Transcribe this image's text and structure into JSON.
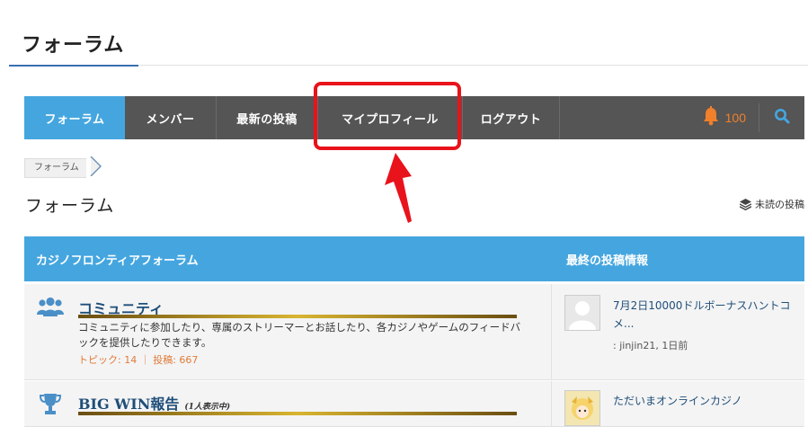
{
  "page": {
    "title": "フォーラム"
  },
  "nav": {
    "items": [
      {
        "label": "フォーラム"
      },
      {
        "label": "メンバー"
      },
      {
        "label": "最新の投稿"
      },
      {
        "label": "マイプロフィール"
      },
      {
        "label": "ログアウト"
      }
    ],
    "notification_count": "100"
  },
  "breadcrumb": {
    "label": "フォーラム"
  },
  "section": {
    "title": "フォーラム",
    "unread_label": "未読の投稿"
  },
  "table": {
    "col_forum": "カジノフロンティアフォーラム",
    "col_last": "最終の投稿情報"
  },
  "forums": [
    {
      "name": "コミュニティ",
      "description": "コミュニティに参加したり、専属のストリーマーとお話したり、各カジノやゲームのフィードバックを提供したりできます。",
      "stats": "トピック: 14 ｜ 投稿: 667",
      "last_title": "7月2日10000ドルボーナスハントコメ...",
      "last_meta": ": jinjin21, 1日前"
    },
    {
      "name": "BIG WIN報告",
      "viewing": "(1人表示中)",
      "last_title": "ただいまオンラインカジノ"
    }
  ],
  "colors": {
    "accent": "#45a6df",
    "nav_bg": "#555555",
    "highlight": "#e8131b",
    "bell": "#f0802a"
  }
}
